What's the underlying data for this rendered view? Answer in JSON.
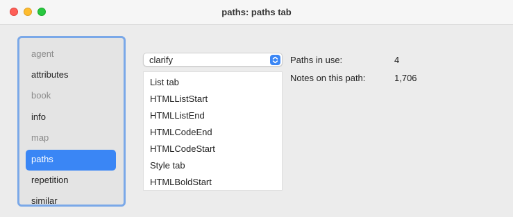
{
  "window": {
    "title": "paths: paths tab"
  },
  "sidebar": {
    "items": [
      {
        "label": "agent",
        "state": "dim"
      },
      {
        "label": "attributes",
        "state": "normal"
      },
      {
        "label": "book",
        "state": "dim"
      },
      {
        "label": "info",
        "state": "normal"
      },
      {
        "label": "map",
        "state": "dim"
      },
      {
        "label": "paths",
        "state": "selected"
      },
      {
        "label": "repetition",
        "state": "normal"
      },
      {
        "label": "similar",
        "state": "normal"
      }
    ]
  },
  "path_popup": {
    "selected": "clarify",
    "icon": "chevron-up-down-icon"
  },
  "path_list": {
    "items": [
      "List tab",
      "HTMLListStart",
      "HTMLListEnd",
      "HTMLCodeEnd",
      "HTMLCodeStart",
      "Style tab",
      "HTMLBoldStart"
    ]
  },
  "stats": {
    "paths_in_use_label": "Paths in use:",
    "paths_in_use_value": "4",
    "notes_label": "Notes on this path:",
    "notes_value": "1,706"
  },
  "colors": {
    "accent": "#3a86f5",
    "sidebar_border": "#7aa8e8",
    "close": "#fe5f57",
    "minimize": "#febc2e",
    "zoom": "#28c840"
  }
}
